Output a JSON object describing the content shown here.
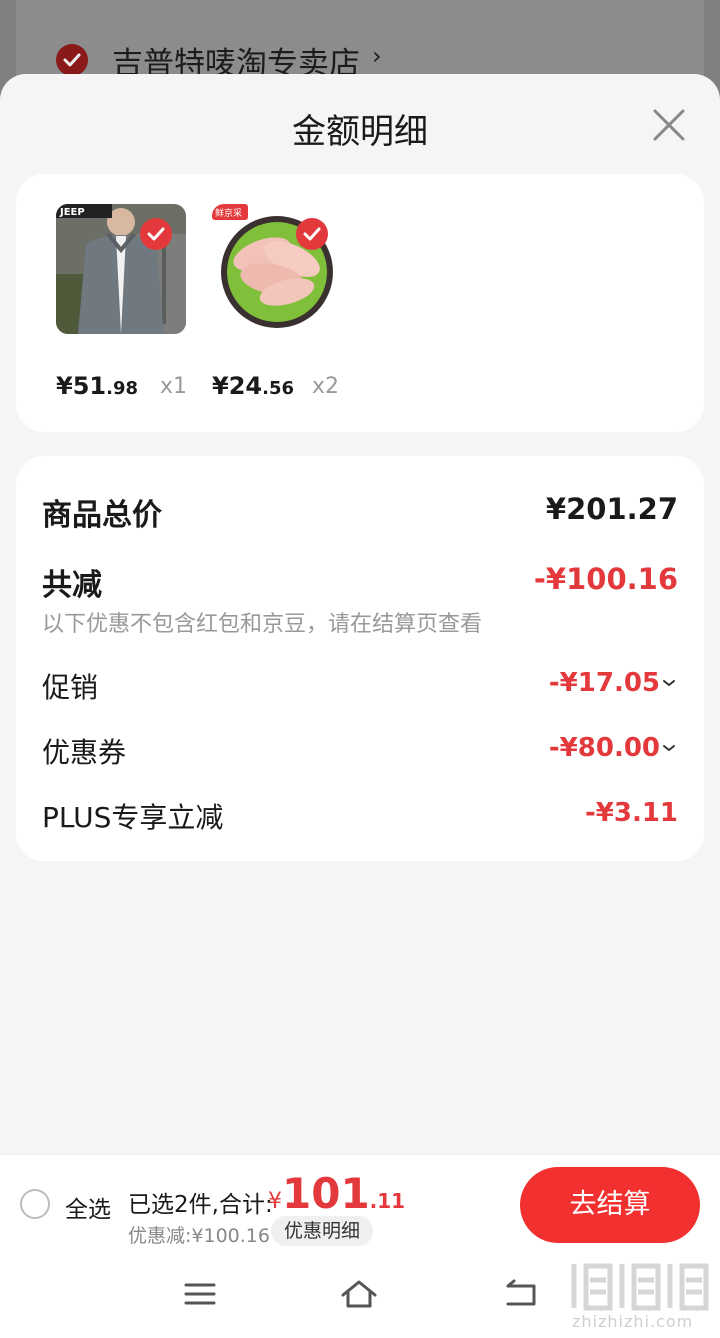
{
  "background": {
    "store_name": "吉普特唛淘专卖店",
    "store_arrow": "›"
  },
  "sheet": {
    "title": "金额明细"
  },
  "products": [
    {
      "image": "jacket-photo",
      "price_int": "¥51",
      "price_dec": ".98",
      "qty": "x1",
      "brand_label": "JEEP"
    },
    {
      "image": "chicken-drumsticks-photo",
      "price_int": "¥24",
      "price_dec": ".56",
      "qty": "x2",
      "brand_label": "鲜京采"
    }
  ],
  "summary": {
    "total_label": "商品总价",
    "total_value": "¥201.27",
    "reduce_label": "共减",
    "reduce_value": "-¥100.16",
    "note": "以下优惠不包含红包和京豆，请在结算页查看",
    "rows": [
      {
        "label": "促销",
        "value": "-¥17.05"
      },
      {
        "label": "优惠券",
        "value": "-¥80.00"
      },
      {
        "label": "PLUS专享立减",
        "value": "-¥3.11"
      }
    ]
  },
  "bottom_bar": {
    "select_all": "全选",
    "selected_text": "已选2件,合计:",
    "total_yen": "¥",
    "total_int": "101",
    "total_dec": ".11",
    "discount_text": "优惠减:¥100.16",
    "detail_chip": "优惠明细",
    "checkout": "去结算"
  },
  "nav_bar": {
    "icons": [
      "menu-icon",
      "home-icon",
      "back-icon"
    ]
  },
  "watermark": {
    "url": "zhizhizhi.com"
  },
  "colors": {
    "accent": "#e4393c",
    "checkout": "#f23030"
  }
}
